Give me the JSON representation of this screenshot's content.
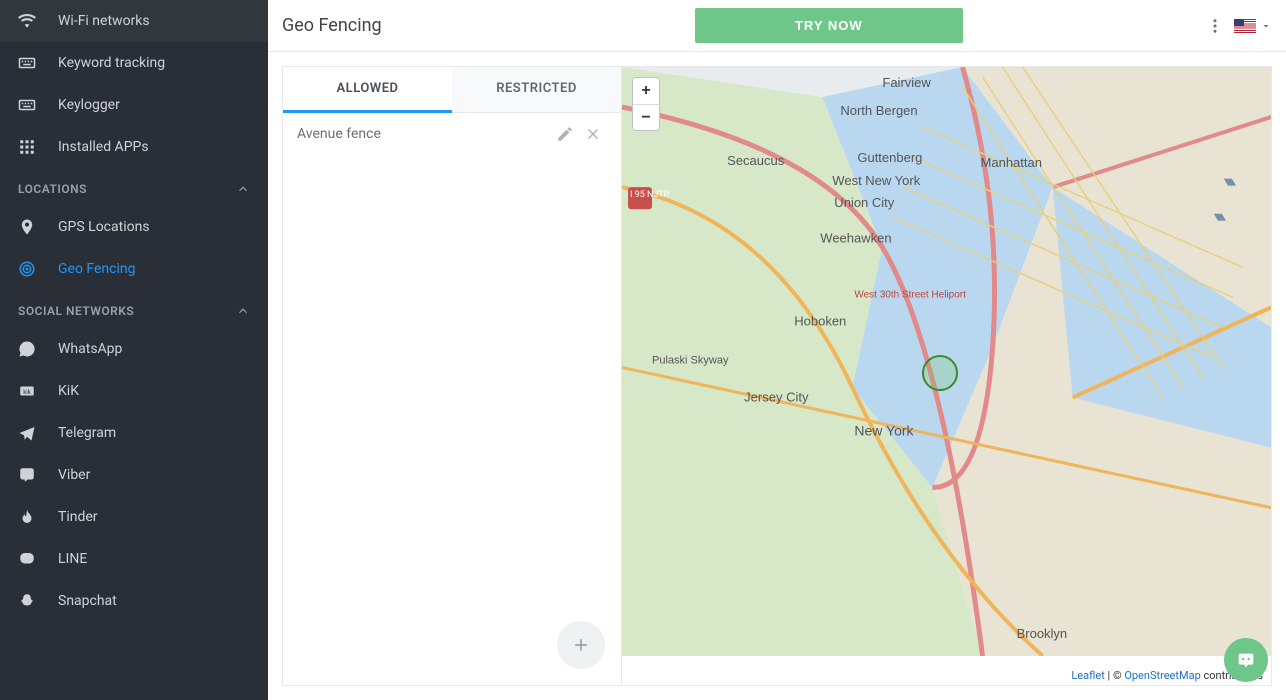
{
  "header": {
    "title": "Geo Fencing",
    "try_now": "TRY NOW"
  },
  "sidebar": {
    "top_items": [
      {
        "label": "Wi-Fi networks",
        "icon": "wifi-icon"
      },
      {
        "label": "Keyword tracking",
        "icon": "keyboard-icon"
      },
      {
        "label": "Keylogger",
        "icon": "keylogger-icon"
      },
      {
        "label": "Installed APPs",
        "icon": "apps-icon"
      }
    ],
    "sections": {
      "locations": {
        "title": "LOCATIONS",
        "items": [
          {
            "label": "GPS Locations",
            "icon": "pin-icon",
            "active": false
          },
          {
            "label": "Geo Fencing",
            "icon": "target-icon",
            "active": true
          }
        ]
      },
      "social": {
        "title": "SOCIAL NETWORKS",
        "items": [
          {
            "label": "WhatsApp",
            "icon": "whatsapp-icon"
          },
          {
            "label": "KiK",
            "icon": "kik-icon"
          },
          {
            "label": "Telegram",
            "icon": "telegram-icon"
          },
          {
            "label": "Viber",
            "icon": "viber-icon"
          },
          {
            "label": "Tinder",
            "icon": "tinder-icon"
          },
          {
            "label": "LINE",
            "icon": "line-icon"
          },
          {
            "label": "Snapchat",
            "icon": "snapchat-icon"
          }
        ]
      }
    }
  },
  "tabs": {
    "allowed": "ALLOWED",
    "restricted": "RESTRICTED"
  },
  "fences": [
    {
      "name": "Avenue fence"
    }
  ],
  "map": {
    "zoom_in": "+",
    "zoom_out": "−",
    "attribution": {
      "leaflet": "Leaflet",
      "sep": " | © ",
      "osm": "OpenStreetMap",
      "tail": " contributors"
    },
    "labels": {
      "fairview": "Fairview",
      "northbergen": "North Bergen",
      "guttenberg": "Guttenberg",
      "secaucus": "Secaucus",
      "westnewyork": "West New York",
      "manhattan": "Manhattan",
      "unioncity": "Union City",
      "weehawken": "Weehawken",
      "hoboken": "Hoboken",
      "pulaski": "Pulaski\nSkyway",
      "jerseycity": "Jersey City",
      "newyork": "New York",
      "brooklyn": "Brooklyn",
      "heliport": "West 30th\nStreet Heliport",
      "i95": "I 95\nNJTP"
    }
  }
}
